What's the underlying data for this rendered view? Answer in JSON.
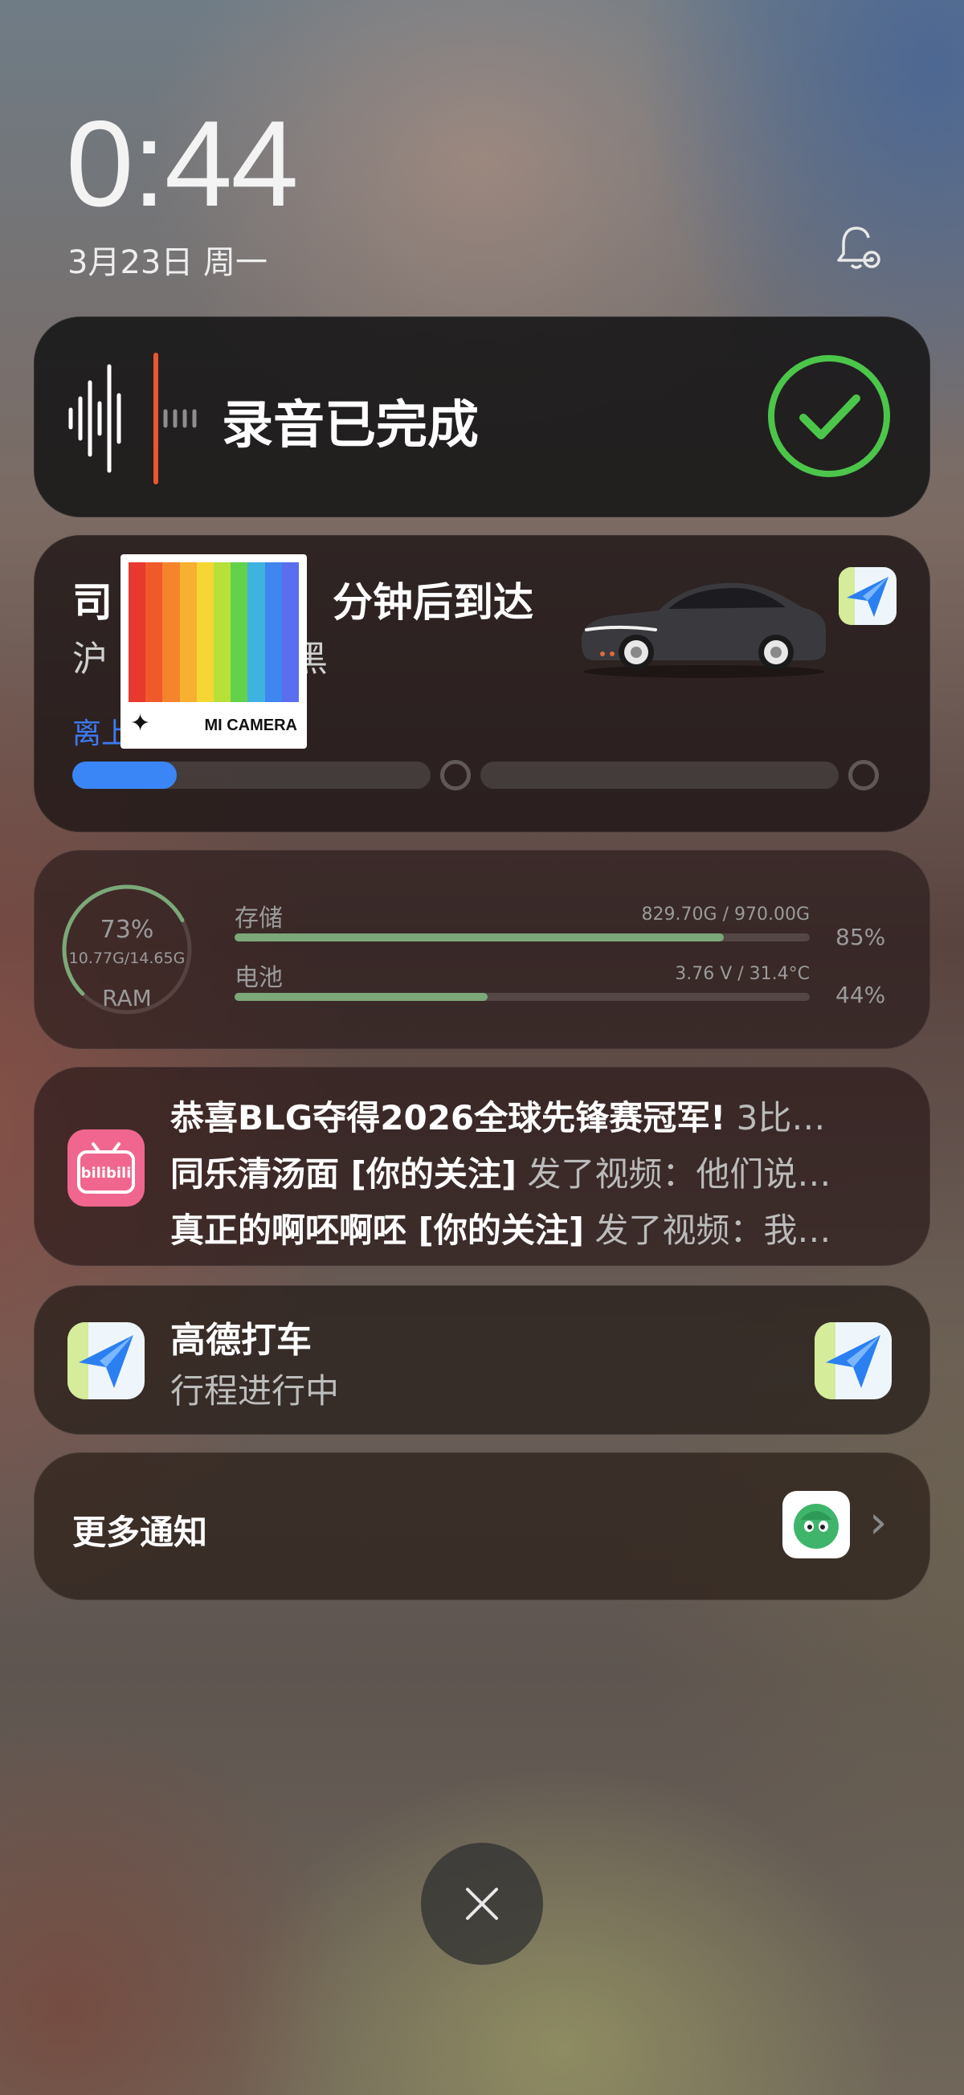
{
  "lockscreen": {
    "time": "0:44",
    "date": "3月23日 周一"
  },
  "recording": {
    "title": "录音已完成",
    "accent_color": "#e8572f",
    "check_color": "#4cc64a"
  },
  "ride": {
    "title_left": "司",
    "title_right": "分钟后到达",
    "plate_left": "沪",
    "plate_right": "黑",
    "status_left": "离上",
    "progress": 0.18,
    "accent_color": "#3a86f6"
  },
  "camera_watermark": {
    "label": "MI CAMERA",
    "stripe_colors": [
      "#e8392f",
      "#f05a2a",
      "#f5842c",
      "#f7b02f",
      "#f6d634",
      "#b7e03a",
      "#62d24a",
      "#3fb3e0",
      "#3f86f0",
      "#5b6ef0"
    ]
  },
  "stats": {
    "ram": {
      "percent": "73%",
      "detail": "10.77G/14.65G",
      "label": "RAM",
      "value": 0.73
    },
    "storage": {
      "label": "存储",
      "detail": "829.70G / 970.00G",
      "percent": "85%",
      "value": 0.85
    },
    "battery": {
      "label": "电池",
      "detail": "3.76 V / 31.4°C",
      "percent": "44%",
      "value": 0.44
    },
    "bar_color": "#7ca879"
  },
  "bilibili": {
    "icon_text": "bilibili",
    "lines": [
      {
        "highlight": "恭喜BLG夺得2026全球先锋赛冠军!",
        "rest": " 3比…"
      },
      {
        "highlight": "同乐清汤面 [你的关注]",
        "rest": " 发了视频：他们说…"
      },
      {
        "highlight": "真正的啊呸啊呸 [你的关注]",
        "rest": " 发了视频：我…"
      }
    ]
  },
  "gaode": {
    "title": "高德打车",
    "subtitle": "行程进行中"
  },
  "more": {
    "label": "更多通知",
    "chevron": "›"
  }
}
